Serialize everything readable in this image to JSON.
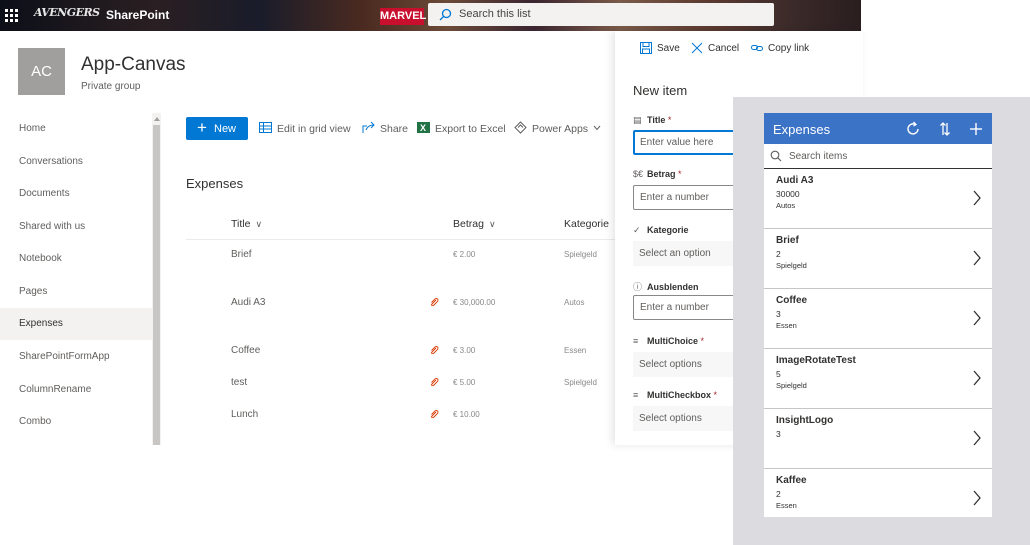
{
  "suite_bar": {
    "brand_logo_text": "AVENGERS",
    "app_name": "SharePoint",
    "banner_text": "MARVEL",
    "search_placeholder": "Search this list"
  },
  "site": {
    "avatar_initials": "AC",
    "title": "App-Canvas",
    "subtitle": "Private group"
  },
  "nav": {
    "items": [
      {
        "label": "Home"
      },
      {
        "label": "Conversations"
      },
      {
        "label": "Documents"
      },
      {
        "label": "Shared with us"
      },
      {
        "label": "Notebook"
      },
      {
        "label": "Pages"
      },
      {
        "label": "Expenses"
      },
      {
        "label": "SharePointFormApp"
      },
      {
        "label": "ColumnRename"
      },
      {
        "label": "Combo"
      }
    ],
    "active": "Expenses"
  },
  "commands": {
    "new_label": "New",
    "edit_grid": "Edit in grid view",
    "share": "Share",
    "export_excel": "Export to Excel",
    "power_apps": "Power Apps"
  },
  "list": {
    "title": "Expenses",
    "columns": {
      "title": "Title",
      "betrag": "Betrag",
      "kategorie": "Kategorie"
    },
    "rows": [
      {
        "title": "Brief",
        "betrag": "€ 2.00",
        "kategorie": "Spielgeld"
      },
      {
        "title": "Audi A3",
        "betrag": "€ 30,000.00",
        "kategorie": "Autos"
      },
      {
        "title": "Coffee",
        "betrag": "€ 3.00",
        "kategorie": "Essen"
      },
      {
        "title": "test",
        "betrag": "€ 5.00",
        "kategorie": "Spielgeld"
      },
      {
        "title": "Lunch",
        "betrag": "€ 10.00",
        "kategorie": ""
      }
    ]
  },
  "panel": {
    "save": "Save",
    "cancel": "Cancel",
    "copy_link": "Copy link",
    "title": "New item",
    "fields": {
      "title_label": "Title",
      "title_value": "Enter value here",
      "betrag_label": "Betrag",
      "betrag_placeholder": "Enter a number",
      "kategorie_label": "Kategorie",
      "kategorie_placeholder": "Select an option",
      "ausblenden_label": "Ausblenden",
      "ausblenden_placeholder": "Enter a number",
      "multichoice_label": "MultiChoice",
      "multichoice_placeholder": "Select options",
      "multicheckbox_label": "MultiCheckbox",
      "multicheckbox_placeholder": "Select options",
      "required_mark": "*"
    }
  },
  "powerapp": {
    "title": "Expenses",
    "search_placeholder": "Search items",
    "items": [
      {
        "title": "Audi A3",
        "amount": "30000",
        "category": "Autos"
      },
      {
        "title": "Brief",
        "amount": "2",
        "category": "Spielgeld"
      },
      {
        "title": "Coffee",
        "amount": "3",
        "category": "Essen"
      },
      {
        "title": "ImageRotateTest",
        "amount": "5",
        "category": "Spielgeld"
      },
      {
        "title": "InsightLogo",
        "amount": "3",
        "category": ""
      },
      {
        "title": "Kaffee",
        "amount": "2",
        "category": "Essen"
      }
    ],
    "header_color": "#3b73c6"
  },
  "colors": {
    "accent": "#0078d4",
    "required": "#a4262c",
    "attachment_icon": "#d83b01"
  }
}
